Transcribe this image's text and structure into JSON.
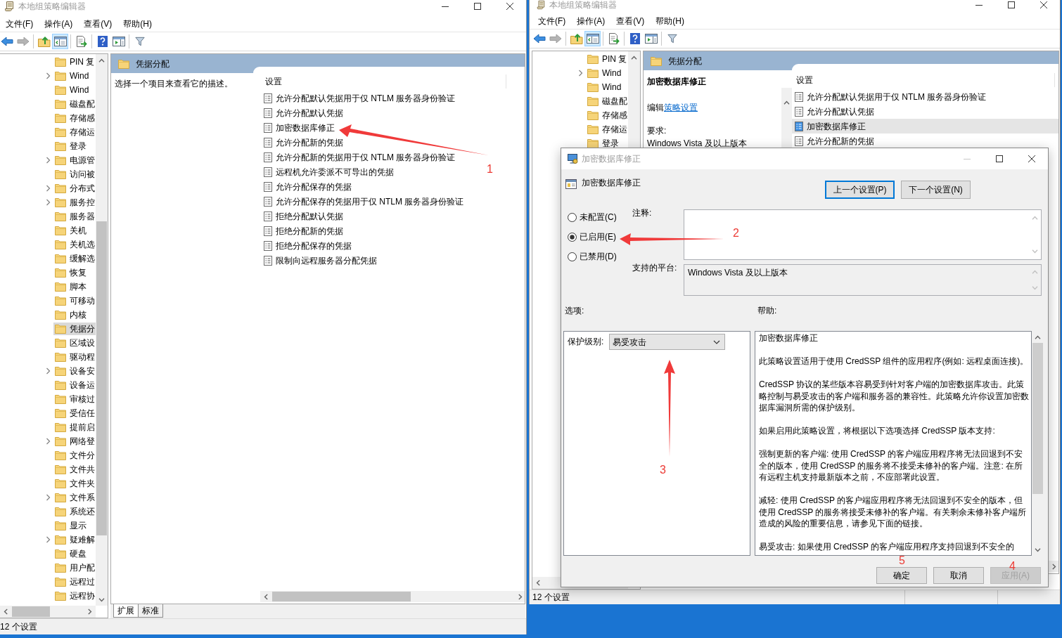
{
  "editors": [
    {
      "title": "本地组策略编辑器",
      "menu": [
        "文件(F)",
        "操作(A)",
        "查看(V)",
        "帮助(H)"
      ],
      "toolbar": [
        {
          "pressed": false,
          "disabled": false
        },
        {
          "pressed": false,
          "disabled": true
        },
        {
          "pressed": false,
          "disabled": false
        },
        {
          "pressed": true,
          "disabled": false
        },
        {
          "pressed": false,
          "disabled": false
        },
        {
          "pressed": false,
          "disabled": false
        },
        {
          "pressed": false,
          "disabled": false
        },
        {
          "pressed": false,
          "disabled": false
        }
      ],
      "tree": [
        {
          "label": "PIN 复",
          "expandable": false,
          "selected": false
        },
        {
          "label": "Wind",
          "expandable": true,
          "selected": false
        },
        {
          "label": "Wind",
          "expandable": false,
          "selected": false
        },
        {
          "label": "磁盘配",
          "expandable": false,
          "selected": false
        },
        {
          "label": "存储感",
          "expandable": false,
          "selected": false
        },
        {
          "label": "存储运",
          "expandable": false,
          "selected": false
        },
        {
          "label": "登录",
          "expandable": false,
          "selected": false
        },
        {
          "label": "电源管",
          "expandable": true,
          "selected": false
        },
        {
          "label": "访问被",
          "expandable": false,
          "selected": false
        },
        {
          "label": "分布式",
          "expandable": true,
          "selected": false
        },
        {
          "label": "服务控",
          "expandable": true,
          "selected": false
        },
        {
          "label": "服务器",
          "expandable": false,
          "selected": false
        },
        {
          "label": "关机",
          "expandable": false,
          "selected": false
        },
        {
          "label": "关机选",
          "expandable": false,
          "selected": false
        },
        {
          "label": "缓解选",
          "expandable": false,
          "selected": false
        },
        {
          "label": "恢复",
          "expandable": false,
          "selected": false
        },
        {
          "label": "脚本",
          "expandable": false,
          "selected": false
        },
        {
          "label": "可移动",
          "expandable": false,
          "selected": false
        },
        {
          "label": "内核",
          "expandable": false,
          "selected": false
        },
        {
          "label": "凭据分",
          "expandable": false,
          "selected": true
        },
        {
          "label": "区域设",
          "expandable": false,
          "selected": false
        },
        {
          "label": "驱动程",
          "expandable": false,
          "selected": false
        },
        {
          "label": "设备安",
          "expandable": true,
          "selected": false
        },
        {
          "label": "设备运",
          "expandable": false,
          "selected": false
        },
        {
          "label": "审核过",
          "expandable": false,
          "selected": false
        },
        {
          "label": "受信任",
          "expandable": false,
          "selected": false
        },
        {
          "label": "提前启",
          "expandable": false,
          "selected": false
        },
        {
          "label": "网络登",
          "expandable": true,
          "selected": false
        },
        {
          "label": "文件分",
          "expandable": false,
          "selected": false
        },
        {
          "label": "文件共",
          "expandable": false,
          "selected": false
        },
        {
          "label": "文件夹",
          "expandable": false,
          "selected": false
        },
        {
          "label": "文件系",
          "expandable": true,
          "selected": false
        },
        {
          "label": "系统还",
          "expandable": false,
          "selected": false
        },
        {
          "label": "显示",
          "expandable": false,
          "selected": false
        },
        {
          "label": "疑难解",
          "expandable": true,
          "selected": false
        },
        {
          "label": "硬盘",
          "expandable": false,
          "selected": false
        },
        {
          "label": "用户配",
          "expandable": false,
          "selected": false
        },
        {
          "label": "远程过",
          "expandable": false,
          "selected": false
        },
        {
          "label": "远程协",
          "expandable": false,
          "selected": false
        }
      ],
      "folder_title": "凭据分配",
      "description": "选择一个项目来查看它的描述。",
      "settings_heading": "设置",
      "settings": [
        {
          "label": "允许分配默认凭据用于仅 NTLM 服务器身份验证",
          "selected": false
        },
        {
          "label": "允许分配默认凭据",
          "selected": false
        },
        {
          "label": "加密数据库修正",
          "selected": false
        },
        {
          "label": "允许分配新的凭据",
          "selected": false
        },
        {
          "label": "允许分配新的凭据用于仅 NTLM 服务器身份验证",
          "selected": false
        },
        {
          "label": "远程机允许委派不可导出的凭据",
          "selected": false
        },
        {
          "label": "允许分配保存的凭据",
          "selected": false
        },
        {
          "label": "允许分配保存的凭据用于仅 NTLM 服务器身份验证",
          "selected": false
        },
        {
          "label": "拒绝分配默认凭据",
          "selected": false
        },
        {
          "label": "拒绝分配新的凭据",
          "selected": false
        },
        {
          "label": "拒绝分配保存的凭据",
          "selected": false
        },
        {
          "label": "限制向远程服务器分配凭据",
          "selected": false
        }
      ],
      "tabs": [
        {
          "label": "扩展",
          "selected": true
        },
        {
          "label": "标准",
          "selected": false
        }
      ],
      "status": "12 个设置"
    },
    {
      "title": "本地组策略编辑器",
      "menu": [
        "文件(F)",
        "操作(A)",
        "查看(V)",
        "帮助(H)"
      ],
      "toolbar": [
        {
          "pressed": false,
          "disabled": false
        },
        {
          "pressed": false,
          "disabled": true
        },
        {
          "pressed": false,
          "disabled": false
        },
        {
          "pressed": true,
          "disabled": false
        },
        {
          "pressed": false,
          "disabled": false
        },
        {
          "pressed": false,
          "disabled": false
        },
        {
          "pressed": false,
          "disabled": false
        },
        {
          "pressed": false,
          "disabled": false
        }
      ],
      "tree": [
        {
          "label": "PIN 复",
          "expandable": false,
          "selected": false
        },
        {
          "label": "Wind",
          "expandable": true,
          "selected": false
        },
        {
          "label": "Wind",
          "expandable": false,
          "selected": false
        },
        {
          "label": "磁盘配",
          "expandable": false,
          "selected": false
        },
        {
          "label": "存储感",
          "expandable": false,
          "selected": false
        },
        {
          "label": "存储运",
          "expandable": false,
          "selected": false
        },
        {
          "label": "登录",
          "expandable": false,
          "selected": false
        }
      ],
      "folder_title": "凭据分配",
      "details": {
        "title": "加密数据库修正",
        "edit_prefix": "编辑",
        "edit_link": "策略设置",
        "requirement_label": "要求:",
        "requirement": "Windows Vista 及以上版本"
      },
      "settings_heading": "设置",
      "settings": [
        {
          "label": "允许分配默认凭据用于仅 NTLM 服务器身份验证",
          "selected": false
        },
        {
          "label": "允许分配默认凭据",
          "selected": false
        },
        {
          "label": "加密数据库修正",
          "selected": true
        },
        {
          "label": "允许分配新的凭据",
          "selected": false
        }
      ],
      "status": "12 个设置"
    }
  ],
  "dialog": {
    "title": "加密数据库修正",
    "setting_name": "加密数据库修正",
    "nav_buttons": [
      {
        "label": "上一个设置(P)",
        "focused": true
      },
      {
        "label": "下一个设置(N)",
        "focused": false
      }
    ],
    "states": [
      {
        "label": "未配置(C)",
        "selected": false
      },
      {
        "label": "已启用(E)",
        "selected": true
      },
      {
        "label": "已禁用(D)",
        "selected": false
      }
    ],
    "comment_label": "注释:",
    "platform_label": "支持的平台:",
    "platform": "Windows Vista 及以上版本",
    "options_label": "选项:",
    "help_label": "帮助:",
    "option": {
      "label": "保护级别:",
      "value": "易受攻击"
    },
    "help": [
      "加密数据库修正",
      "此策略设置适用于使用 CredSSP 组件的应用程序(例如: 远程桌面连接)。",
      "CredSSP 协议的某些版本容易受到针对客户端的加密数据库攻击。此策略控制与易受攻击的客户端和服务器的兼容性。此策略允许你设置加密数据库漏洞所需的保护级别。",
      "如果启用此策略设置，将根据以下选项选择 CredSSP 版本支持:",
      "强制更新的客户端: 使用 CredSSP 的客户端应用程序将无法回退到不安全的版本，使用 CredSSP 的服务将不接受未修补的客户端。注意: 在所有远程主机支持最新版本之前，不应部署此设置。",
      "减轻: 使用 CredSSP 的客户端应用程序将无法回退到不安全的版本，但使用 CredSSP 的服务将接受未修补的客户端。有关剩余未修补客户端所造成的风险的重要信息，请参见下面的链接。",
      "易受攻击: 如果使用 CredSSP 的客户端应用程序支持回退到不安全的"
    ],
    "buttons": [
      {
        "label": "确定",
        "disabled": false
      },
      {
        "label": "取消",
        "disabled": false
      },
      {
        "label": "应用(A)",
        "disabled": true
      }
    ]
  },
  "annotations": [
    {
      "label": "1",
      "kind": "arrow"
    },
    {
      "label": "2",
      "kind": "arrow"
    },
    {
      "label": "3",
      "kind": "arrow"
    },
    {
      "label": "4",
      "kind": "number"
    },
    {
      "label": "5",
      "kind": "number"
    }
  ]
}
